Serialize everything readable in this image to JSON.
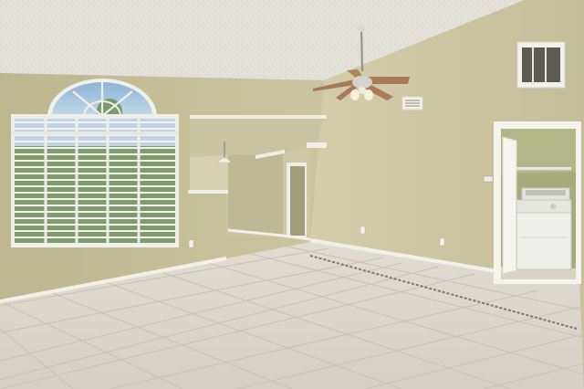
{
  "scene": {
    "colors": {
      "ceiling": "#e4e2dc",
      "wall_left": "#c7c199",
      "wall_right": "#c9c3a0",
      "wall_back": "#cfc9a8",
      "floor": "#dcd6ca",
      "grout": "#c9c2b4",
      "baseboard": "#f2f0ea",
      "trim": "#f5f3ee",
      "laundry_wall": "#a9ad7c",
      "washer": "#eeeeea",
      "sky": "#8fb6d8",
      "foliage": "#6f8f5a",
      "fan_blade": "#a87a55"
    },
    "icons": [
      "ceiling-fan-icon",
      "washer-icon",
      "air-vent-icon",
      "outlet-icon"
    ]
  }
}
